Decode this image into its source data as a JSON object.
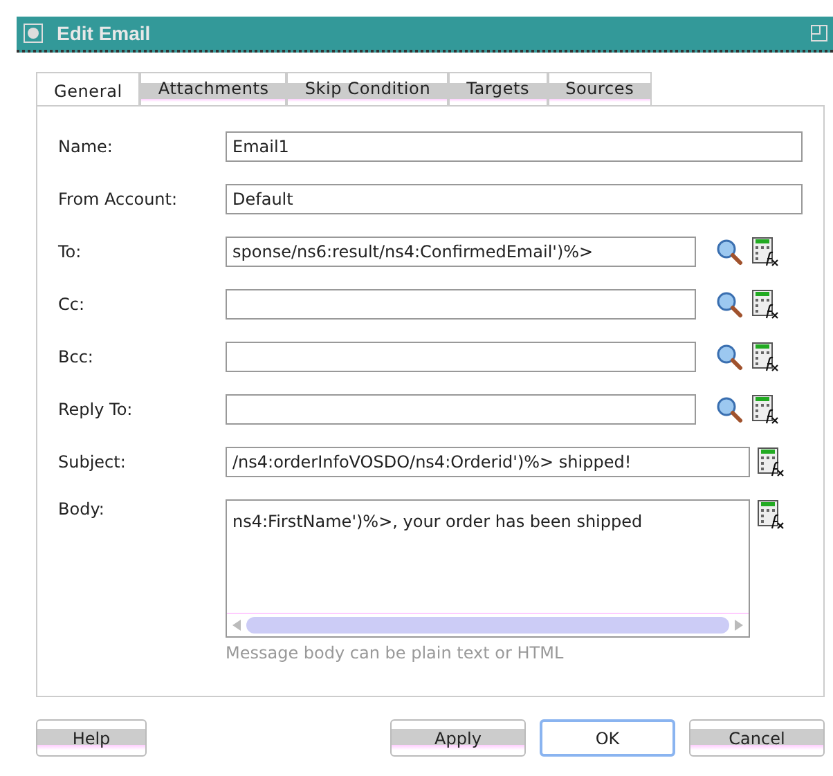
{
  "window": {
    "title": "Edit Email"
  },
  "tabs": [
    {
      "label": "General",
      "selected": true
    },
    {
      "label": "Attachments",
      "selected": false
    },
    {
      "label": "Skip Condition",
      "selected": false
    },
    {
      "label": "Targets",
      "selected": false
    },
    {
      "label": "Sources",
      "selected": false
    }
  ],
  "fields": [
    {
      "label": "Name:",
      "value": "Email1",
      "lookup": false,
      "expression": false
    },
    {
      "label": "From Account:",
      "value": "Default",
      "lookup": false,
      "expression": false
    },
    {
      "label": "To:",
      "value": "sponse/ns6:result/ns4:ConfirmedEmail')%>",
      "lookup": true,
      "expression": true
    },
    {
      "label": "Cc:",
      "lookup": true,
      "expression": true
    },
    {
      "label": "Bcc:",
      "lookup": true,
      "expression": true
    },
    {
      "label": "Reply To:",
      "lookup": true,
      "expression": true
    },
    {
      "label": "Subject:",
      "value": "/ns4:orderInfoVOSDO/ns4:Orderid')%> shipped!",
      "lookup": false,
      "expression": true
    }
  ],
  "body": {
    "label": "Body:",
    "value": "ns4:FirstName')%>, your order has been shipped",
    "expression": true,
    "hint": "Message body can be plain text or HTML"
  },
  "buttons": [
    {
      "label": "Help",
      "default": false
    },
    {
      "label": "Apply",
      "default": false
    },
    {
      "label": "OK",
      "default": true
    },
    {
      "label": "Cancel",
      "default": false
    }
  ]
}
